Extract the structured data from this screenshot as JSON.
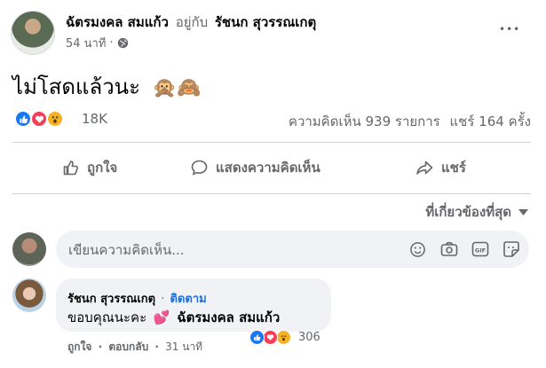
{
  "post": {
    "author": "ฉัตรมงคล สมแก้ว",
    "with_text": "อยู่กับ",
    "tagged": "รัชนก สุวรรณเกตุ",
    "time": "54 นาที",
    "dot": "·",
    "text": "ไม่โสดแล้วนะ",
    "emoji": "🙊🙈",
    "more_label": "•••"
  },
  "stats": {
    "reaction_count": "18K",
    "comments": "ความคิดเห็น 939 รายการ",
    "shares": "แชร์ 164 ครั้ง"
  },
  "actions": {
    "like": "ถูกใจ",
    "comment": "แสดงความคิดเห็น",
    "share": "แชร์"
  },
  "sort": {
    "label": "ที่เกี่ยวข้องที่สุด"
  },
  "comment_input": {
    "placeholder": "เขียนความคิดเห็น..."
  },
  "comment": {
    "author": "รัชนก สุวรรณเกตุ",
    "dot": "·",
    "follow": "ติดตาม",
    "text_before": "ขอบคุณนะคะ",
    "heart": "💕",
    "mention": "ฉัตรมงคล สมแก้ว",
    "like": "ถูกใจ",
    "reply": "ตอบกลับ",
    "time": "31 นาที",
    "reaction_count": "306"
  },
  "colors": {
    "like_blue": "#1877f2",
    "love_red": "#f33e58",
    "wow_yellow": "#f7b125",
    "muted": "#65676b",
    "input_bg": "#f0f2f5"
  }
}
